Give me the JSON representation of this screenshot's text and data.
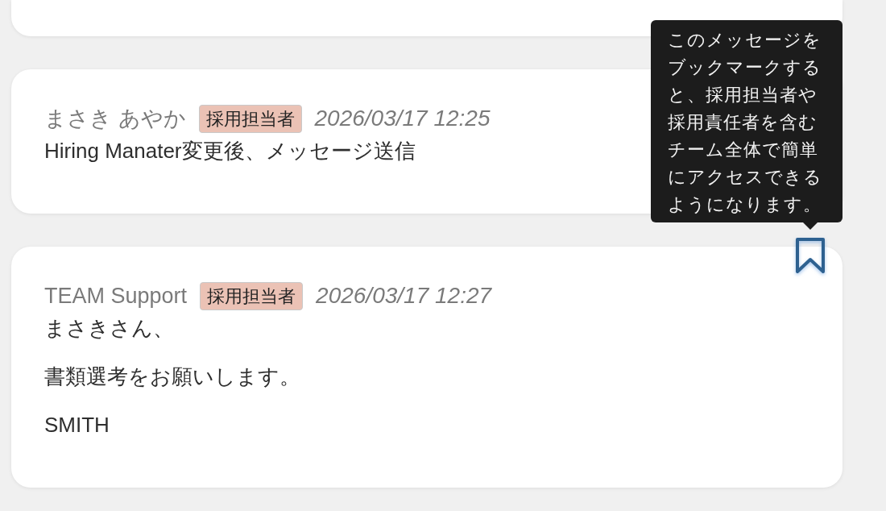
{
  "messages": [
    {
      "sender": "まさき あやか",
      "role_badge": "採用担当者",
      "timestamp": "2026/03/17 12:25",
      "paragraphs": [
        "Hiring Manater変更後、メッセージ送信"
      ]
    },
    {
      "sender": "TEAM Support",
      "role_badge": "採用担当者",
      "timestamp": "2026/03/17 12:27",
      "paragraphs": [
        "まさきさん、",
        "書類選考をお願いします。",
        "SMITH"
      ],
      "bookmark": {
        "bookmarked": false,
        "tooltip": "このメッセージをブックマークすると、採用担当者や採用責任者を含むチーム全体で簡単にアクセスできるようになります。"
      }
    }
  ]
}
